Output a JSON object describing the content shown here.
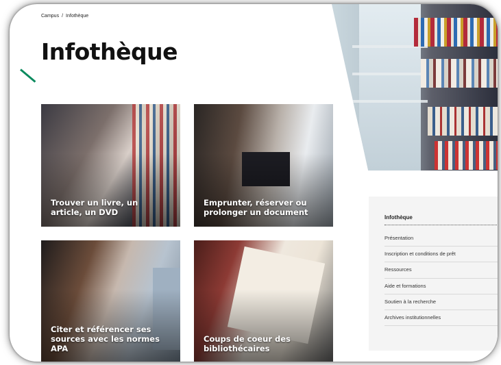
{
  "breadcrumb": {
    "items": [
      "Campus",
      "Infothèque"
    ],
    "separator": "/"
  },
  "page": {
    "title": "Infothèque"
  },
  "cards": [
    {
      "label": "Trouver un livre, un article, un DVD"
    },
    {
      "label": "Emprunter, réserver ou prolonger un document"
    },
    {
      "label": "Citer et référencer ses sources avec les normes APA"
    },
    {
      "label": "Coups de coeur des bibliothécaires"
    }
  ],
  "side_menu": {
    "title": "Infothèque",
    "items": [
      "Présentation",
      "Inscription et conditions de prêt",
      "Ressources",
      "Aide et formations",
      "Soutien à la recherche",
      "Archives institutionnelles"
    ]
  },
  "colors": {
    "accent": "#0b8a5e",
    "menu_bg": "#f4f4f4",
    "title": "#111111"
  }
}
